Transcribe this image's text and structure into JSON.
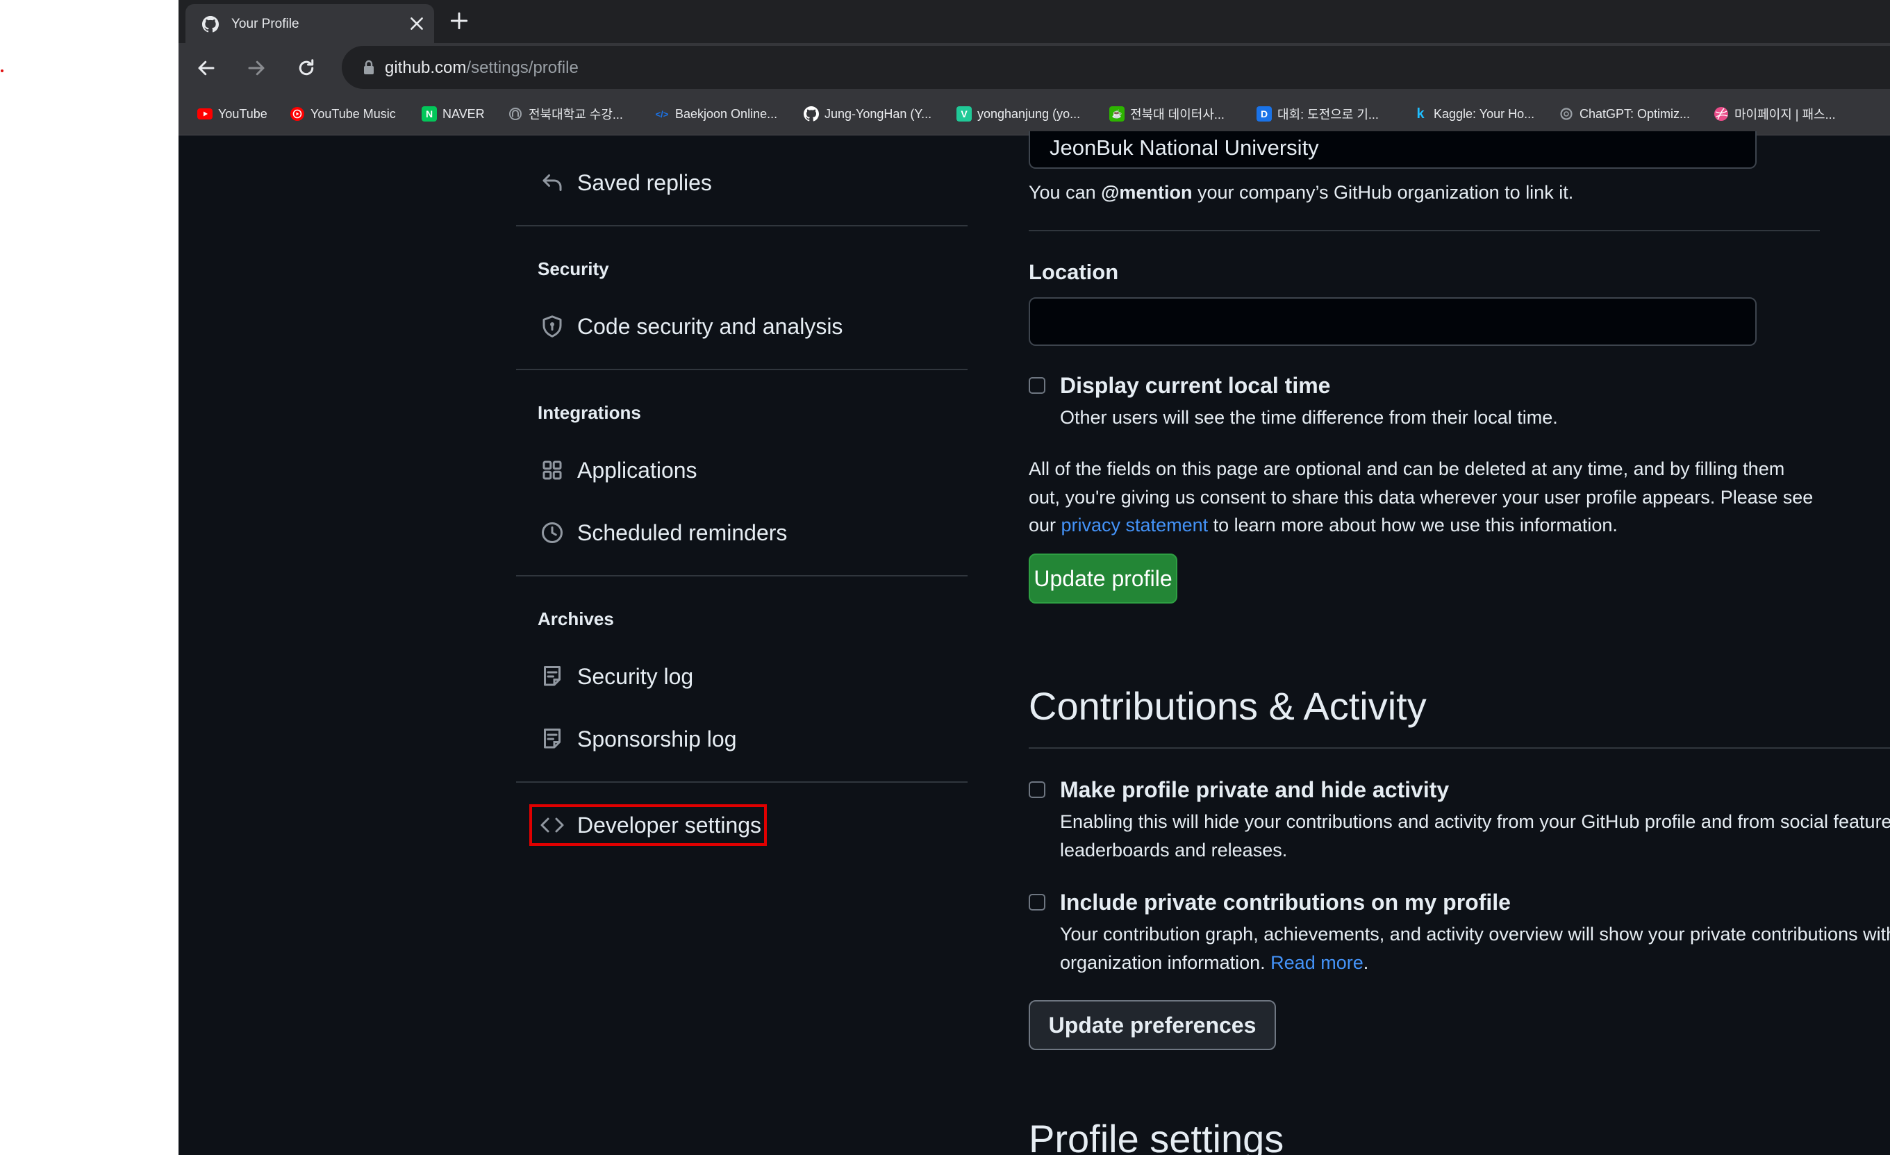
{
  "browser": {
    "tab_title": "Your Profile",
    "url_host": "github.com",
    "url_path": "/settings/profile",
    "bookmarks": [
      {
        "label": "YouTube",
        "icon": "youtube-icon",
        "color": "#ff0000"
      },
      {
        "label": "YouTube Music",
        "icon": "youtube-music-icon",
        "color": "#ff0000"
      },
      {
        "label": "NAVER",
        "icon": "naver-icon",
        "color": "#03c75a"
      },
      {
        "label": "전북대학교 수강...",
        "icon": "university-icon",
        "color": "#9aa0a6"
      },
      {
        "label": "Baekjoon Online...",
        "icon": "code-icon",
        "color": "#1a73e8"
      },
      {
        "label": "Jung-YongHan (Y...",
        "icon": "github-icon",
        "color": "#ffffff"
      },
      {
        "label": "yonghanjung (yo...",
        "icon": "velog-icon",
        "color": "#20c997"
      },
      {
        "label": "전북대 데이터사...",
        "icon": "coffee-icon",
        "color": "#2db400"
      },
      {
        "label": "대회: 도전으로 기...",
        "icon": "dacon-icon",
        "color": "#1a73e8"
      },
      {
        "label": "Kaggle: Your Ho...",
        "icon": "kaggle-icon",
        "color": "#20beff"
      },
      {
        "label": "ChatGPT: Optimiz...",
        "icon": "chatgpt-icon",
        "color": "#9aa0a6"
      },
      {
        "label": "마이페이지 | 패스...",
        "icon": "dribbble-icon",
        "color": "#ea4c89"
      }
    ]
  },
  "sidebar": {
    "saved_replies": "Saved replies",
    "security_heading": "Security",
    "code_security": "Code security and analysis",
    "integrations_heading": "Integrations",
    "applications": "Applications",
    "scheduled_reminders": "Scheduled reminders",
    "archives_heading": "Archives",
    "security_log": "Security log",
    "sponsorship_log": "Sponsorship log",
    "developer_settings": "Developer settings"
  },
  "profile": {
    "company_value": "JeonBuk National University",
    "company_hint_pre": "You can ",
    "company_hint_bold": "@mention",
    "company_hint_post": " your company’s GitHub organization to link it.",
    "location_label": "Location",
    "location_value": "",
    "local_time_label": "Display current local time",
    "local_time_desc": "Other users will see the time difference from their local time.",
    "optional_line1": "All of the fields on this page are optional and can be deleted at any time, and by filling them",
    "optional_line2": "out, you're giving us consent to share this data wherever your user profile appears. Please see",
    "optional_line3_pre": "our ",
    "optional_link": "privacy statement",
    "optional_line3_post": " to learn more about how we use this information.",
    "update_button": "Update profile"
  },
  "contributions": {
    "heading": "Contributions & Activity",
    "private_label": "Make profile private and hide activity",
    "private_desc1": "Enabling this will hide your contributions and activity from your GitHub profile and from social features like",
    "private_desc2": "leaderboards and releases.",
    "include_label": "Include private contributions on my profile",
    "include_desc1": "Your contribution graph, achievements, and activity overview will show your private contributions without revealing any repository or",
    "include_desc2_pre": "organization information. ",
    "include_link": "Read more",
    "include_desc2_post": ".",
    "update_button": "Update preferences",
    "next_heading": "Profile settings"
  }
}
